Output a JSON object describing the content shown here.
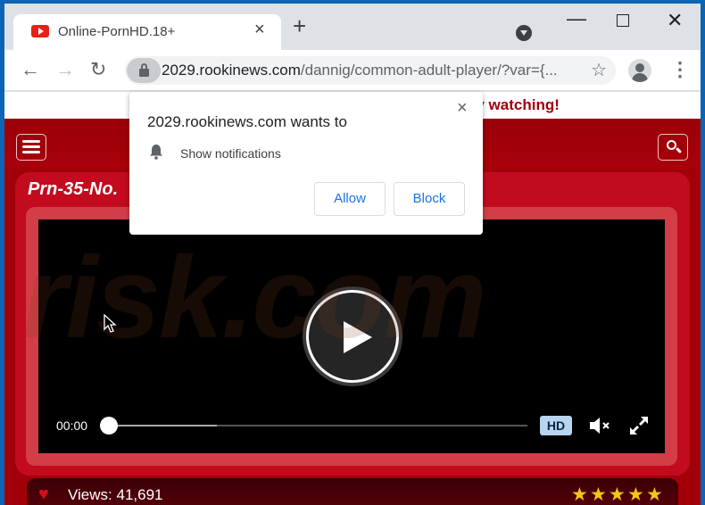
{
  "browser": {
    "tab": {
      "title": "Online-PornHD.18+",
      "favicon": "youtube-play-icon",
      "close_icon": "×"
    },
    "new_tab_icon": "+",
    "window_controls": {
      "minimize": "—",
      "close": "✕"
    },
    "nav": {
      "back": "←",
      "forward": "→",
      "reload": "↻"
    },
    "address": {
      "host": "2029.rookinews.com",
      "path": "/dannig/common-adult-player/?var={...",
      "bookmark_icon": "☆"
    },
    "menu_icon": "⋮"
  },
  "permission_popup": {
    "title": "2029.rookinews.com wants to",
    "permission": "Show notifications",
    "allow_label": "Allow",
    "block_label": "Block",
    "close_icon": "×"
  },
  "page": {
    "banner_text": "by watching!",
    "video_title": "Prn-35-No.",
    "player": {
      "time": "00:00",
      "buffered_fraction": 0.26,
      "played_fraction": 0.0,
      "hd_label": "HD",
      "muted": true
    },
    "info": {
      "heart_icon": "♥",
      "views": "Views: 41,691",
      "rating": 5,
      "stars": [
        "★",
        "★",
        "★",
        "★",
        "★"
      ]
    },
    "watermark": "risk.com"
  }
}
